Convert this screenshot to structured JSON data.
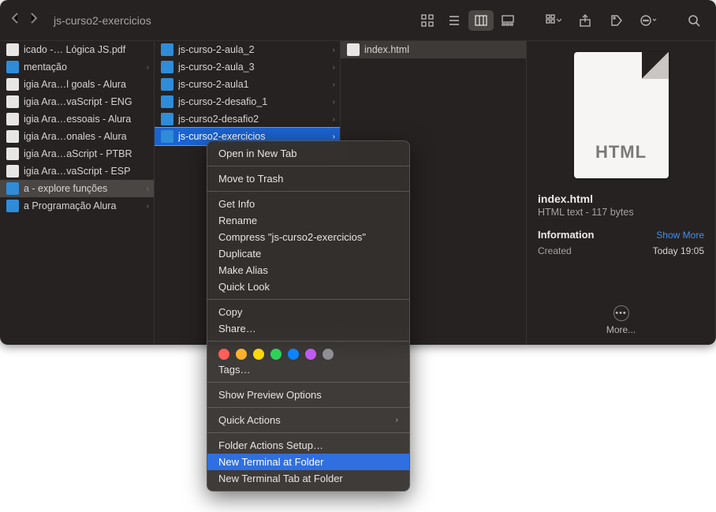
{
  "toolbar": {
    "breadcrumb": "js-curso2-exercicios"
  },
  "col1": [
    {
      "label": "icado -… Lógica JS.pdf",
      "icon": "file"
    },
    {
      "label": "mentação",
      "icon": "folder",
      "chev": true
    },
    {
      "label": "igia Ara…l goals - Alura",
      "icon": "file"
    },
    {
      "label": "igia Ara…vaScript - ENG",
      "icon": "file"
    },
    {
      "label": "igia Ara…essoais - Alura",
      "icon": "file"
    },
    {
      "label": "igia Ara…onales - Alura",
      "icon": "file"
    },
    {
      "label": "igia Ara…aScript - PTBR",
      "icon": "file"
    },
    {
      "label": "igia Ara…vaScript - ESP",
      "icon": "file"
    },
    {
      "label": "a - explore funções",
      "icon": "folder",
      "chev": true,
      "sel": "dim"
    },
    {
      "label": "a Programação Alura",
      "icon": "folder",
      "chev": true
    }
  ],
  "col2": [
    {
      "label": "js-curso-2-aula_2",
      "chev": true
    },
    {
      "label": "js-curso-2-aula_3",
      "chev": true
    },
    {
      "label": "js-curso-2-aula1",
      "chev": true
    },
    {
      "label": "js-curso-2-desafio_1",
      "chev": true
    },
    {
      "label": "js-curso2-desafio2",
      "chev": true
    },
    {
      "label": "js-curso2-exercicios",
      "chev": true,
      "sel": "bright"
    }
  ],
  "col3": [
    {
      "label": "index.html",
      "icon": "file",
      "sel": "dim2"
    }
  ],
  "preview": {
    "ext": "HTML",
    "filename": "index.html",
    "desc": "HTML text - 117 bytes",
    "info_label": "Information",
    "show_more": "Show More",
    "created_k": "Created",
    "created_v": "Today 19:05",
    "more": "More..."
  },
  "ctx": {
    "open_tab": "Open in New Tab",
    "trash": "Move to Trash",
    "getinfo": "Get Info",
    "rename": "Rename",
    "compress": "Compress \"js-curso2-exercicios\"",
    "duplicate": "Duplicate",
    "alias": "Make Alias",
    "quicklook": "Quick Look",
    "copy": "Copy",
    "share": "Share…",
    "tags_label": "Tags…",
    "preview_opts": "Show Preview Options",
    "quick_actions": "Quick Actions",
    "folder_actions": "Folder Actions Setup…",
    "new_term": "New Terminal at Folder",
    "new_term_tab": "New Terminal Tab at Folder",
    "tag_colors": [
      "#ff5f57",
      "#ffb02e",
      "#ffd60a",
      "#30d158",
      "#0a84ff",
      "#bf5af2",
      "#8e8e93"
    ]
  }
}
